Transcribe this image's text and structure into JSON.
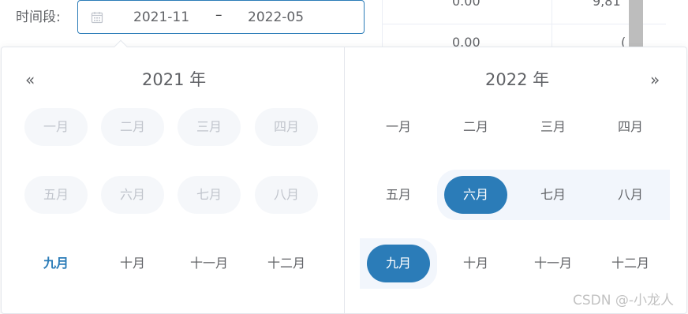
{
  "background_table": {
    "cell_a": "0.00",
    "cell_b": "9,81",
    "cell_c": "0.00",
    "cell_d": "("
  },
  "range": {
    "label": "时间段:",
    "start": "2021-11",
    "separator": "–",
    "end": "2022-05",
    "icon": "calendar-icon"
  },
  "left_panel": {
    "title": "2021 年",
    "prev_label": "«",
    "months": [
      "一月",
      "二月",
      "三月",
      "四月",
      "五月",
      "六月",
      "七月",
      "八月",
      "九月",
      "十月",
      "十一月",
      "十二月"
    ]
  },
  "right_panel": {
    "title": "2022 年",
    "next_label": "»",
    "months": [
      "一月",
      "二月",
      "三月",
      "四月",
      "五月",
      "六月",
      "七月",
      "八月",
      "九月",
      "十月",
      "十一月",
      "十二月"
    ]
  },
  "colors": {
    "accent": "#2b7cb8",
    "disabled_bg": "#f5f7fa",
    "range_bg": "#f2f6fc"
  },
  "watermark": "CSDN @-小龙人"
}
